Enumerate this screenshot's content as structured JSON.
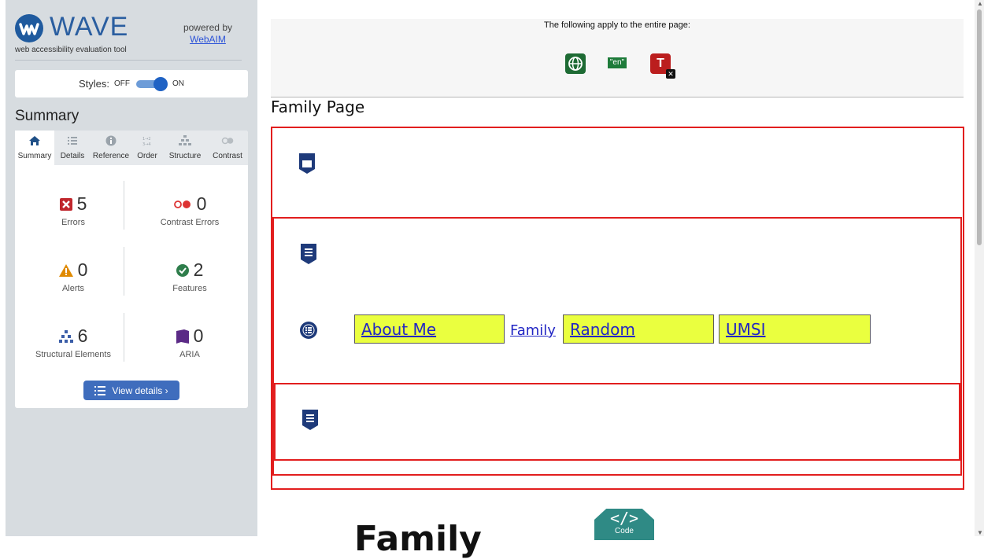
{
  "brand": {
    "name": "WAVE",
    "subtitle": "web accessibility evaluation tool",
    "powered_by": "powered by",
    "powered_link": "WebAIM"
  },
  "styles": {
    "label": "Styles:",
    "off": "OFF",
    "on": "ON"
  },
  "summary_heading": "Summary",
  "tabs": [
    {
      "label": "Summary",
      "icon": "home-icon"
    },
    {
      "label": "Details",
      "icon": "list-icon"
    },
    {
      "label": "Reference",
      "icon": "info-icon"
    },
    {
      "label": "Order",
      "icon": "order-icon"
    },
    {
      "label": "Structure",
      "icon": "structure-icon"
    },
    {
      "label": "Contrast",
      "icon": "contrast-icon"
    }
  ],
  "stats": {
    "errors": {
      "value": "5",
      "label": "Errors"
    },
    "contrast_errors": {
      "value": "0",
      "label": "Contrast Errors"
    },
    "alerts": {
      "value": "0",
      "label": "Alerts"
    },
    "features": {
      "value": "2",
      "label": "Features"
    },
    "structural": {
      "value": "6",
      "label": "Structural Elements"
    },
    "aria": {
      "value": "0",
      "label": "ARIA"
    }
  },
  "view_details": "View details ›",
  "page": {
    "note": "The following apply to the entire page:",
    "lang_badge": "\"en\"",
    "title": "Family Page",
    "nav": [
      "About Me",
      "Family",
      "Random",
      "UMSI"
    ],
    "heading_partial": "Family",
    "code_badge": {
      "symbol": "</>",
      "label": "Code"
    }
  },
  "colors": {
    "sidebar_bg": "#d7dce0",
    "accent": "#3f6dbd",
    "error": "#c0272d",
    "region_outline": "#e21e1e",
    "link_highlight": "#eaff3f"
  }
}
